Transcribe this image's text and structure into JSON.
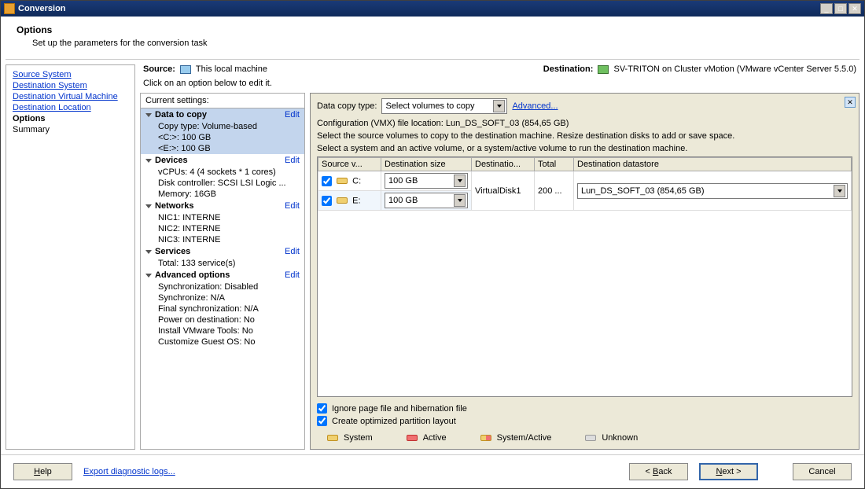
{
  "window": {
    "title": "Conversion"
  },
  "header": {
    "title": "Options",
    "subtitle": "Set up the parameters for the conversion task"
  },
  "sidebar": {
    "items": [
      {
        "label": "Source System",
        "type": "link"
      },
      {
        "label": "Destination System",
        "type": "link"
      },
      {
        "label": "Destination Virtual Machine",
        "type": "link"
      },
      {
        "label": "Destination Location",
        "type": "link"
      },
      {
        "label": "Options",
        "type": "active"
      },
      {
        "label": "Summary",
        "type": "plain"
      }
    ]
  },
  "source": {
    "label": "Source:",
    "value": "This local machine"
  },
  "destination": {
    "label": "Destination:",
    "value": "SV-TRITON on Cluster vMotion (VMware vCenter Server 5.5.0)"
  },
  "instruction": "Click on an option below to edit it.",
  "settings": {
    "header": "Current settings:",
    "edit_label": "Edit",
    "groups": [
      {
        "title": "Data to copy",
        "selected": true,
        "items": [
          {
            "text": "Copy type: Volume-based",
            "selected": true
          },
          {
            "text": "<C:>: 100 GB",
            "selected": true
          },
          {
            "text": "<E:>: 100 GB",
            "selected": true
          }
        ]
      },
      {
        "title": "Devices",
        "items": [
          {
            "text": "vCPUs: 4 (4 sockets * 1 cores)"
          },
          {
            "text": "Disk controller: SCSI LSI Logic ..."
          },
          {
            "text": "Memory: 16GB"
          }
        ]
      },
      {
        "title": "Networks",
        "items": [
          {
            "text": "NIC1: INTERNE"
          },
          {
            "text": "NIC2: INTERNE"
          },
          {
            "text": "NIC3: INTERNE"
          }
        ]
      },
      {
        "title": "Services",
        "items": [
          {
            "text": "Total: 133 service(s)"
          }
        ]
      },
      {
        "title": "Advanced options",
        "items": [
          {
            "text": "Synchronization: Disabled"
          },
          {
            "text": "Synchronize: N/A"
          },
          {
            "text": "Final synchronization: N/A"
          },
          {
            "text": "Power on destination: No"
          },
          {
            "text": "Install VMware Tools: No"
          },
          {
            "text": "Customize Guest OS: No"
          }
        ]
      }
    ]
  },
  "details": {
    "copy_type_label": "Data copy type:",
    "copy_type_value": "Select volumes to copy",
    "advanced": "Advanced...",
    "vmx_location": "Configuration (VMX) file location: Lun_DS_SOFT_03 (854,65 GB)",
    "help1": "Select the source volumes to copy to the destination machine. Resize destination disks to add or save space.",
    "help2": "Select a system and an active volume, or a system/active volume to run the destination machine.",
    "columns": [
      "Source v...",
      "Destination size",
      "Destinatio...",
      "Total",
      "Destination datastore"
    ],
    "rows": [
      {
        "drive": "C:",
        "size": "100 GB",
        "disk": "VirtualDisk1",
        "total": "200 ...",
        "datastore": "Lun_DS_SOFT_03 (854,65 GB)"
      },
      {
        "drive": "E:",
        "size": "100 GB"
      }
    ],
    "ignore_pagefile": "Ignore page file and hibernation file",
    "optimized_layout": "Create optimized partition layout",
    "legend": {
      "system": "System",
      "active": "Active",
      "system_active": "System/Active",
      "unknown": "Unknown"
    }
  },
  "footer": {
    "help": "Help",
    "export": "Export diagnostic logs...",
    "back": "< Back",
    "next": "Next >",
    "cancel": "Cancel"
  }
}
